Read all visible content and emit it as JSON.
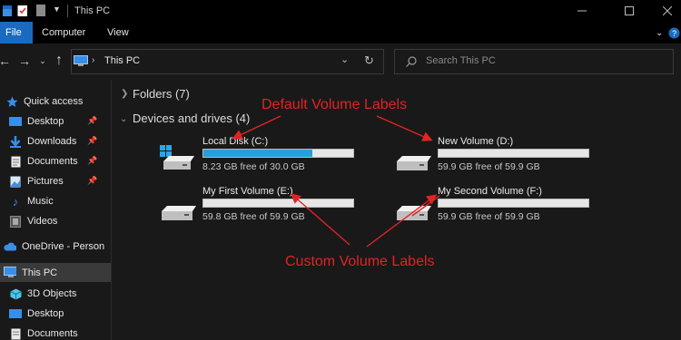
{
  "window": {
    "title": "This PC",
    "controls": [
      "minimize-icon",
      "maximize-icon",
      "close-icon"
    ]
  },
  "ribbon": {
    "tabs": [
      {
        "label": "File",
        "active": true
      },
      {
        "label": "Computer"
      },
      {
        "label": "View"
      }
    ]
  },
  "address": {
    "path": "This PC",
    "search_placeholder": "Search This PC"
  },
  "nav_pane": {
    "quick_access": {
      "label": "Quick access",
      "items": [
        {
          "label": "Desktop",
          "icon": "desktop-folder-icon",
          "pinned": true
        },
        {
          "label": "Downloads",
          "icon": "download-arrow-icon",
          "pinned": true
        },
        {
          "label": "Documents",
          "icon": "documents-icon",
          "pinned": true
        },
        {
          "label": "Pictures",
          "icon": "pictures-icon",
          "pinned": true
        },
        {
          "label": "Music",
          "icon": "music-note-icon",
          "pinned": false
        },
        {
          "label": "Videos",
          "icon": "videos-icon",
          "pinned": false
        }
      ]
    },
    "onedrive": {
      "label": "OneDrive - Person"
    },
    "this_pc": {
      "label": "This PC",
      "items": [
        {
          "label": "3D Objects",
          "icon": "3d-objects-icon"
        },
        {
          "label": "Desktop",
          "icon": "desktop-folder-icon"
        },
        {
          "label": "Documents",
          "icon": "documents-icon"
        }
      ]
    }
  },
  "content": {
    "folders_header": "Folders (7)",
    "devices_header": "Devices and drives (4)",
    "drives": [
      {
        "name": "Local Disk (C:)",
        "free_text": "8.23 GB free of 30.0 GB",
        "used_fraction": 0.73,
        "icon": "windows-drive-icon"
      },
      {
        "name": "New Volume (D:)",
        "free_text": "59.9 GB free of 59.9 GB",
        "used_fraction": 0.0,
        "icon": "drive-icon"
      },
      {
        "name": "My First Volume (E:)",
        "free_text": "59.8 GB free of 59.9 GB",
        "used_fraction": 0.0,
        "icon": "drive-icon"
      },
      {
        "name": "My Second Volume (F:)",
        "free_text": "59.9 GB free of 59.9 GB",
        "used_fraction": 0.0,
        "icon": "drive-icon"
      }
    ]
  },
  "annotations": {
    "default_labels": "Default Volume Labels",
    "custom_labels": "Custom Volume Labels",
    "color": "#e02424"
  },
  "colors": {
    "accent": "#1a6bbf",
    "bar_fill": "#26a0da",
    "background": "#191919"
  }
}
